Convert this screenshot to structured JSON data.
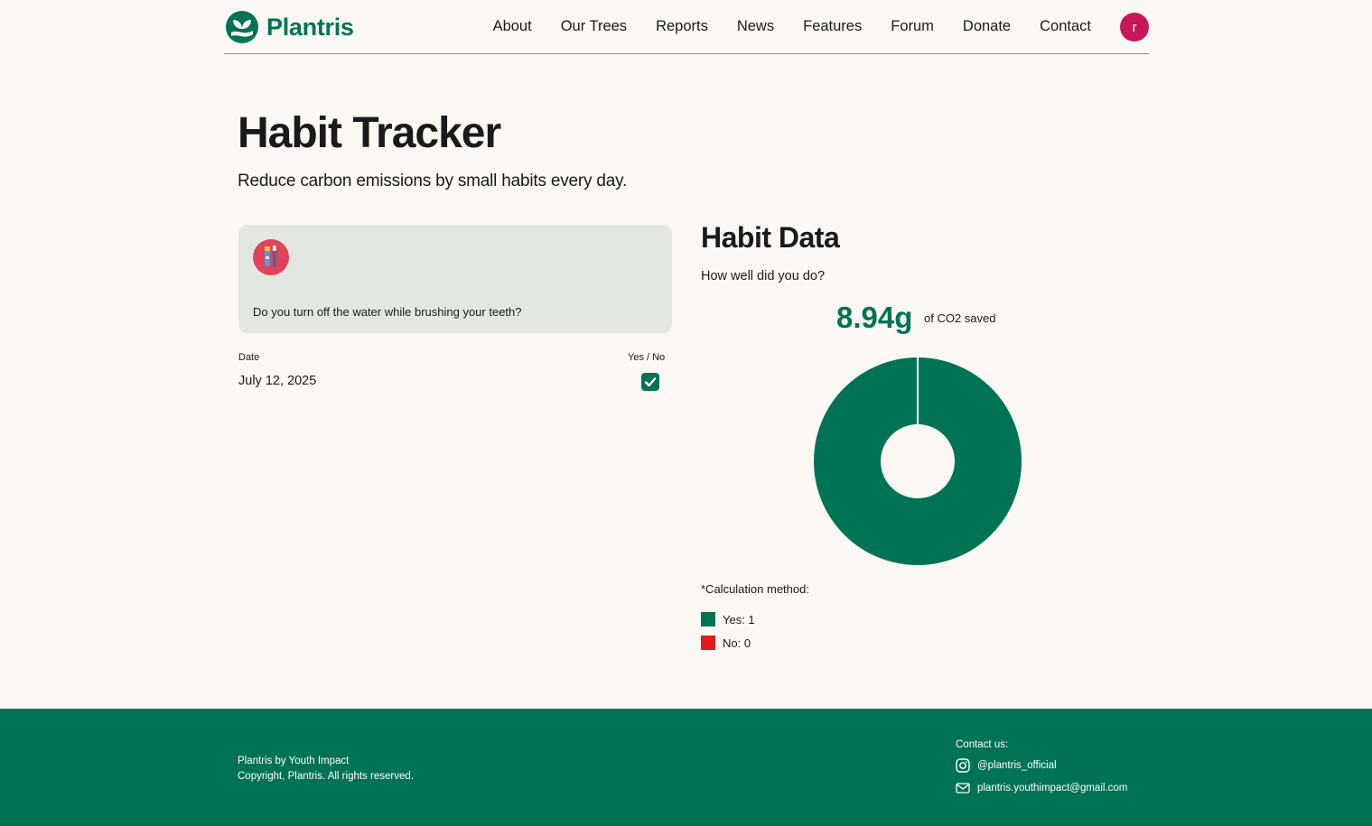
{
  "header": {
    "brand": "Plantris",
    "nav": [
      "About",
      "Our Trees",
      "Reports",
      "News",
      "Features",
      "Forum",
      "Donate",
      "Contact"
    ],
    "avatar_initial": "r"
  },
  "page": {
    "title": "Habit Tracker",
    "subtitle": "Reduce carbon emissions by small habits every day."
  },
  "habit": {
    "icon": "toothbrush-icon",
    "question": "Do you turn off the water while brushing your teeth?",
    "date_label": "Date",
    "yesno_label": "Yes / No",
    "date": "July 12, 2025",
    "checked": true
  },
  "habit_data": {
    "title": "Habit Data",
    "subtitle": "How well did you do?",
    "co2_value": "8.94g",
    "co2_label": "of CO2 saved",
    "calc_label": "*Calculation method:",
    "legend": [
      {
        "label": "Yes: 1",
        "color": "#007355"
      },
      {
        "label": "No: 0",
        "color": "#e21b1b"
      }
    ]
  },
  "chart_data": {
    "type": "pie",
    "categories": [
      "Yes",
      "No"
    ],
    "values": [
      1,
      0
    ],
    "colors": [
      "#007355",
      "#e21b1b"
    ],
    "donut": true
  },
  "footer": {
    "line1": "Plantris by Youth Impact",
    "line2": "Copyright, Plantris. All rights reserved.",
    "contact_label": "Contact us:",
    "instagram": "@plantris_official",
    "email": "plantris.youthimpact@gmail.com"
  },
  "colors": {
    "brand": "#007355",
    "background": "#fbf7f2",
    "card": "#e2e8e0",
    "avatar": "#c8175a"
  }
}
